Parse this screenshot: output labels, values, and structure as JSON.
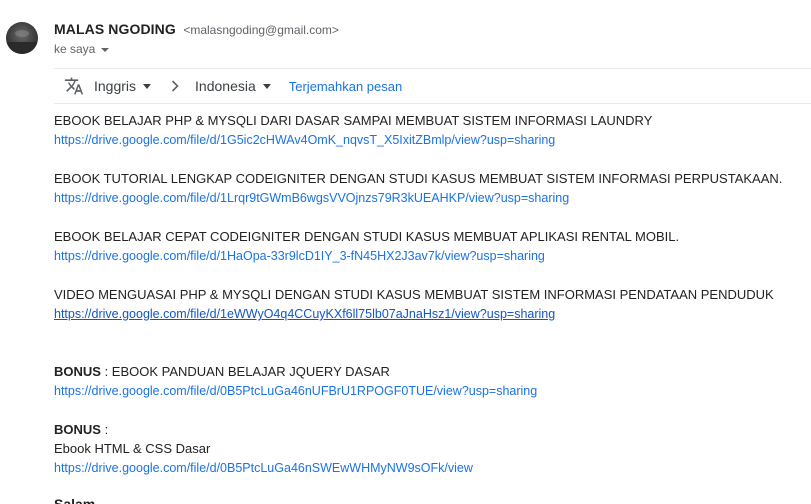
{
  "sender": {
    "name": "MALAS NGODING",
    "email": "<malasngoding@gmail.com>",
    "recipient_label": "ke saya"
  },
  "translate": {
    "source_lang": "Inggris",
    "target_lang": "Indonesia",
    "translate_link": "Terjemahkan pesan"
  },
  "items": [
    {
      "title": "EBOOK BELAJAR PHP & MYSQLI DARI DASAR SAMPAI MEMBUAT SISTEM INFORMASI LAUNDRY",
      "url": "https://drive.google.com/file/d/1G5ic2cHWAv4OmK_nqvsT_X5IxitZBmlp/view?usp=sharing"
    },
    {
      "title": "EBOOK TUTORIAL LENGKAP CODEIGNITER DENGAN STUDI KASUS MEMBUAT SISTEM INFORMASI PERPUSTAKAAN.",
      "url": "https://drive.google.com/file/d/1Lrqr9tGWmB6wgsVVOjnzs79R3kUEAHKP/view?usp=sharing"
    },
    {
      "title": "EBOOK BELAJAR CEPAT CODEIGNITER DENGAN STUDI KASUS MEMBUAT APLIKASI RENTAL MOBIL.",
      "url": "https://drive.google.com/file/d/1HaOpa-33r9lcD1IY_3-fN45HX2J3av7k/view?usp=sharing"
    },
    {
      "title": "VIDEO MENGUASAI PHP & MYSQLI DENGAN STUDI KASUS MEMBUAT SISTEM INFORMASI PENDATAAN PENDUDUK",
      "url": "https://drive.google.com/file/d/1eWWyO4q4CCuyKXf6ll75lb07aJnaHsz1/view?usp=sharing"
    }
  ],
  "bonus1": {
    "label": "BONUS",
    "text": " : EBOOK PANDUAN BELAJAR JQUERY DASAR",
    "url": "https://drive.google.com/file/d/0B5PtcLuGa46nUFBrU1RPOGF0TUE/view?usp=sharing"
  },
  "bonus2": {
    "label": "BONUS",
    "text": " :",
    "line2": "Ebook HTML & CSS Dasar",
    "url": "https://drive.google.com/file/d/0B5PtcLuGa46nSWEwWHMyNW9sOFk/view"
  },
  "cutoff_text": "Salam,"
}
